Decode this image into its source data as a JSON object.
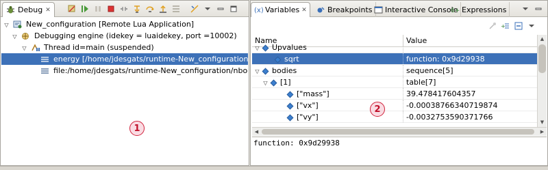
{
  "debug": {
    "tab_label": "Debug",
    "tab_close": "✕",
    "tree": [
      {
        "label": "New_configuration [Remote Lua Application]",
        "twisty": "▽",
        "level": 0
      },
      {
        "label": "Debugging engine (idekey = luaidekey, port =10002)",
        "twisty": "▽",
        "level": 1
      },
      {
        "label": "Thread id=main (suspended)",
        "twisty": "▽",
        "level": 2
      },
      {
        "label": "energy [/home/jdesgats/runtime-New_configuration/nbody/src/main.lua]",
        "twisty": "",
        "level": 3,
        "selected": true
      },
      {
        "label": "file:/home/jdesgats/runtime-New_configuration/nbody/src/main.lua",
        "twisty": "",
        "level": 3
      }
    ],
    "marker": "1"
  },
  "variables": {
    "tabs": [
      "Variables",
      "Breakpoints",
      "Interactive Console",
      "Expressions"
    ],
    "tab_close": "✕",
    "columns": {
      "name": "Name",
      "value": "Value"
    },
    "rows": [
      {
        "name": "Upvalues",
        "value": "",
        "twisty": "▽",
        "level": 0,
        "cut": true
      },
      {
        "name": "sqrt",
        "value": "function: 0x9d29938",
        "twisty": "",
        "level": 1,
        "selected": true
      },
      {
        "name": "bodies",
        "value": "sequence[5]",
        "twisty": "▽",
        "level": 0
      },
      {
        "name": "[1]",
        "value": "table[7]",
        "twisty": "▽",
        "level": 1
      },
      {
        "name": "[\"mass\"]",
        "value": "39.478417604357",
        "twisty": "",
        "level": 2
      },
      {
        "name": "[\"vx\"]",
        "value": "-0.00038766340719874",
        "twisty": "",
        "level": 2
      },
      {
        "name": "[\"vy\"]",
        "value": "-0.0032753590371766",
        "twisty": "",
        "level": 2
      }
    ],
    "detail": "function: 0x9d29938",
    "marker": "2"
  },
  "colors": {
    "selection": "#3d71b8",
    "marker": "#d0203a",
    "accent_icon": "#3c7fcf"
  }
}
